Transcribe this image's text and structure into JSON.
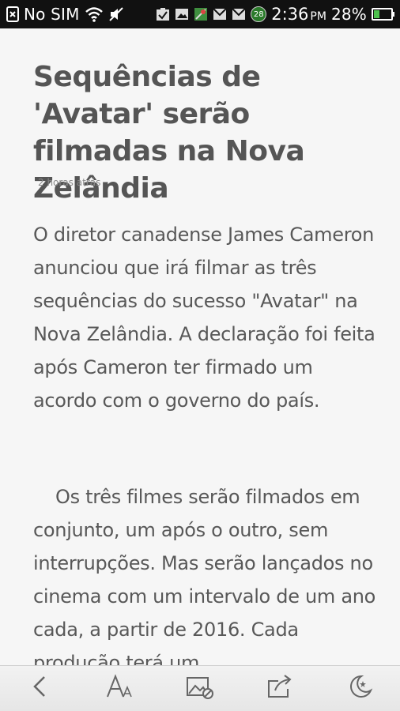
{
  "status_bar": {
    "carrier": "No SIM",
    "notification_count": "28",
    "time": "2:36",
    "ampm": "PM",
    "battery": "28%"
  },
  "article": {
    "title": "Sequências de 'Avatar' serão filmadas na Nova Zelândia",
    "timestamp": "2 horas atrás",
    "paragraphs": [
      "O diretor canadense James Cameron anunciou que irá filmar as três sequências do sucesso \"Avatar\" na Nova Zelândia. A declaração foi feita após Cameron ter firmado um acordo com o governo do país.",
      "Os três filmes serão filmados em conjunto, um após o outro, sem interrupções. Mas serão lançados no cinema com um intervalo de um ano cada, a partir de 2016. Cada produção terá um"
    ]
  },
  "toolbar": {
    "buttons": [
      {
        "icon": "back-icon"
      },
      {
        "icon": "font-size-icon"
      },
      {
        "icon": "image-toggle-icon"
      },
      {
        "icon": "share-icon"
      },
      {
        "icon": "night-mode-icon"
      }
    ]
  }
}
